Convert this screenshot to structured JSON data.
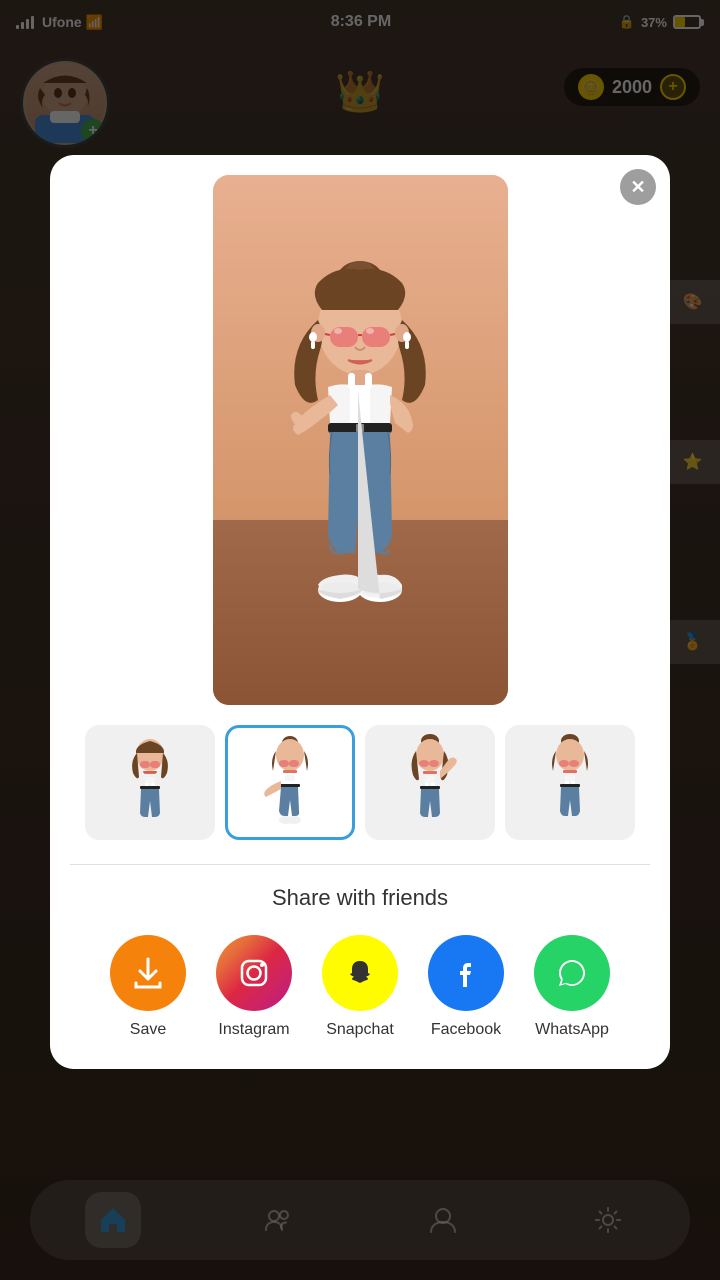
{
  "statusBar": {
    "carrier": "Ufone",
    "time": "8:36 PM",
    "battery": "37%",
    "batteryColor": "#ffd700"
  },
  "background": {
    "coins": "2000"
  },
  "modal": {
    "shareTitle": "Share with friends",
    "closeLabel": "×",
    "apps": [
      {
        "id": "save",
        "label": "Save",
        "icon": "save"
      },
      {
        "id": "instagram",
        "label": "Instagram",
        "icon": "instagram"
      },
      {
        "id": "snapchat",
        "label": "Snapchat",
        "icon": "snapchat"
      },
      {
        "id": "facebook",
        "label": "Facebook",
        "icon": "facebook"
      },
      {
        "id": "whatsapp",
        "label": "WhatsApp",
        "icon": "whatsapp"
      }
    ]
  },
  "thumbnails": [
    {
      "id": 1,
      "active": false
    },
    {
      "id": 2,
      "active": true
    },
    {
      "id": 3,
      "active": false
    },
    {
      "id": 4,
      "active": false
    }
  ]
}
